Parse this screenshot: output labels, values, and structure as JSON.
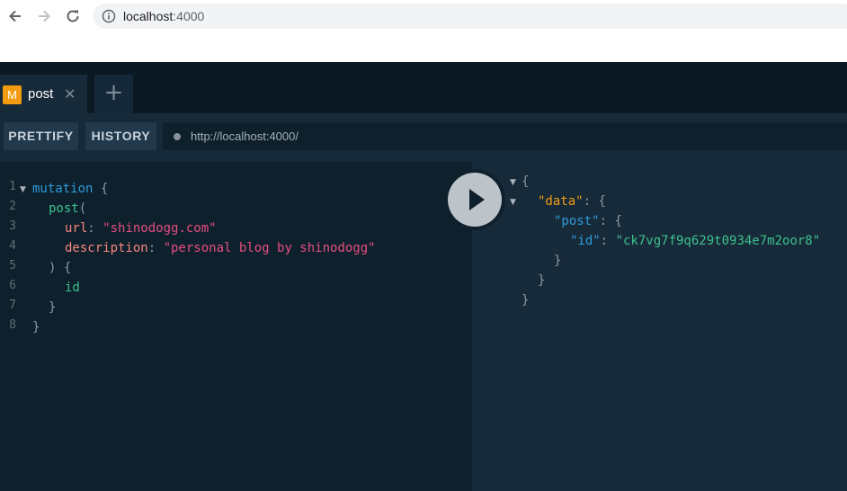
{
  "browser": {
    "url_host": "localhost",
    "url_port": ":4000"
  },
  "tabs": [
    {
      "badge": "M",
      "label": "post",
      "close": "✕"
    }
  ],
  "tab_add": "+",
  "toolbar": {
    "prettify": "PRETTIFY",
    "history": "HISTORY",
    "endpoint": "http://localhost:4000/"
  },
  "editor": {
    "line_numbers": [
      "1",
      "2",
      "3",
      "4",
      "5",
      "6",
      "7",
      "8"
    ],
    "l1_kw": "mutation",
    "l1_brace": " {",
    "l2_field": "post",
    "l2_paren": "(",
    "l3_arg": "url",
    "l3_colon": ": ",
    "l3_str": "\"shinodogg.com\"",
    "l4_arg": "description",
    "l4_colon": ": ",
    "l4_str": "\"personal blog by shinodogg\"",
    "l5": ") {",
    "l6_field": "id",
    "l7": "}",
    "l8": "}"
  },
  "result": {
    "open": "{",
    "data_key": "\"data\"",
    "colon": ": ",
    "open2": "{",
    "post_key": "\"post\"",
    "open3": "{",
    "id_key": "\"id\"",
    "id_value": "\"ck7vg7f9q629t0934e7m2oor8\"",
    "close3": "}",
    "close2": "}",
    "close1": "}"
  },
  "colors": {
    "app_bg": "#0f202d",
    "keyword": "#2d9bd8",
    "field": "#3dc18c",
    "argument": "#f4877c",
    "string": "#e44e7e",
    "result_key": "#f39c12",
    "tab_badge": "#f29b10"
  }
}
